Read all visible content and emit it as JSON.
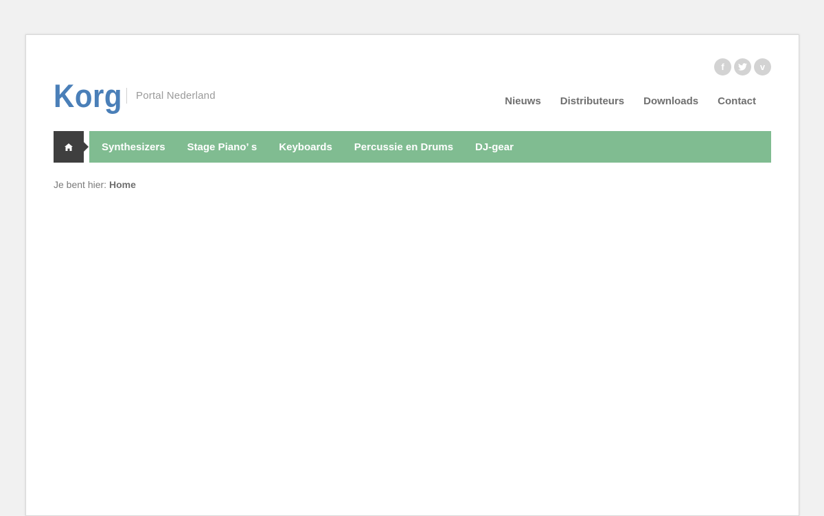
{
  "brand": {
    "logo_text": "Korg",
    "tagline": "Portal Nederland",
    "logo_color": "#4a7fb8"
  },
  "social": [
    {
      "name": "facebook",
      "glyph": "f"
    },
    {
      "name": "twitter",
      "glyph": "twitter-bird"
    },
    {
      "name": "vimeo",
      "glyph": "v"
    }
  ],
  "top_nav": {
    "items": [
      "Nieuws",
      "Distributeurs",
      "Downloads",
      "Contact"
    ]
  },
  "main_nav": {
    "home_icon": "home-icon",
    "accent_color": "#80bc91",
    "home_bg": "#3f3f3f",
    "items": [
      "Synthesizers",
      "Stage Piano’ s",
      "Keyboards",
      "Percussie en Drums",
      "DJ-gear"
    ]
  },
  "breadcrumb": {
    "prefix": "Je bent hier:",
    "current": "Home"
  }
}
